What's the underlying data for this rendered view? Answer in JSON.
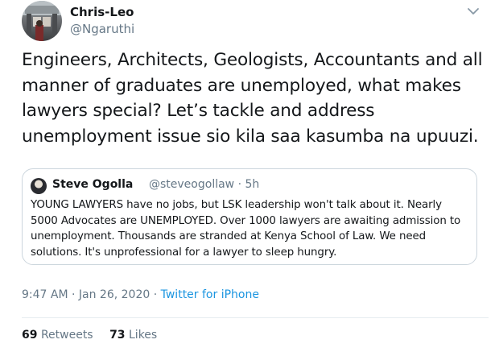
{
  "author": {
    "name": "Chris-Leo",
    "handle": "@Ngaruthi"
  },
  "tweet": {
    "text": "Engineers, Architects, Geologists, Accountants and all manner of graduates are unemployed, what makes lawyers special? Let’s tackle and address unemployment issue sio kila saa kasumba na upuuzi."
  },
  "quoted": {
    "name": "Steve Ogolla",
    "handle_time": "@steveogollaw · 5h",
    "text": "YOUNG LAWYERS have no jobs, but LSK leadership won't talk about it. Nearly 5000 Advocates are UNEMPLOYED. Over 1000 lawyers are awaiting admission to unemployment. Thousands are stranded at Kenya School of Law. We need solutions. It's unprofessional for a lawyer to sleep hungry."
  },
  "meta": {
    "timestamp": "9:47 AM · Jan 26, 2020 · ",
    "source": "Twitter for iPhone"
  },
  "stats": {
    "retweets_count": "69",
    "retweets_label": "Retweets",
    "likes_count": "73",
    "likes_label": "Likes"
  },
  "colors": {
    "link": "#1b95e0",
    "secondary": "#657786",
    "border": "#ccd6dd"
  },
  "icons": {
    "caret": "chevron-down-icon"
  }
}
